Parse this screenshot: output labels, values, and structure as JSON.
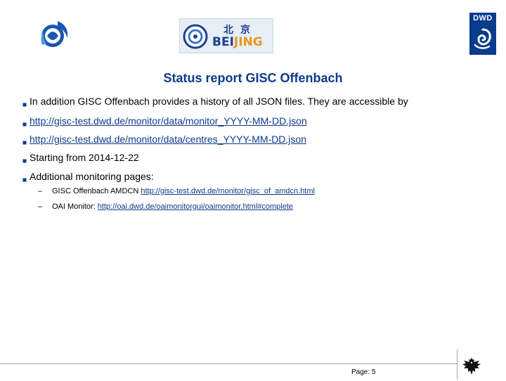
{
  "logos": {
    "dwd_text": "DWD",
    "beijing_cn": "北京",
    "beijing_en_prefix": "BEI",
    "beijing_en_suffix": "JING"
  },
  "title": "Status report GISC Offenbach",
  "bullets": [
    {
      "text": "In addition GISC Offenbach provides a history of all JSON files. They are accessible by"
    },
    {
      "text": "http://gisc-test.dwd.de/monitor/data/monitor_YYYY-MM-DD.json"
    },
    {
      "text": "http://gisc-test.dwd.de/monitor/data/centres_YYYY-MM-DD.json"
    },
    {
      "text": "Starting from 2014-12-22"
    },
    {
      "text": "Additional monitoring pages:"
    }
  ],
  "sub_items": [
    {
      "dash": "–",
      "label": "GISC Offenbach AMDCN ",
      "link": "http://gisc-test.dwd.de/monitor/gisc_of_amdcn.html"
    },
    {
      "dash": "–",
      "label": "OAI Monitor: ",
      "link": "http://oai.dwd.de/oaimonitorgui/oaimonitor.html#complete"
    }
  ],
  "footer": {
    "page_label": "Page: 5"
  },
  "colors": {
    "accent": "#0b3b8c",
    "link": "#0b3b8c",
    "beijing_orange": "#e59a1b"
  }
}
